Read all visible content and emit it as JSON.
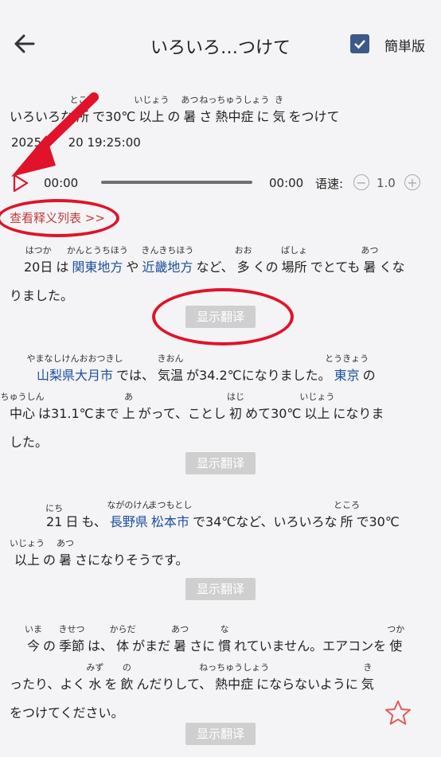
{
  "header": {
    "title": "いろいろ…つけて",
    "simple_label": "簡単版",
    "simple_checked": true
  },
  "headline": {
    "line": [
      {
        "t": "いろいろな",
        "r": ""
      },
      {
        "t": "所",
        "r": "ところ"
      },
      {
        "t": "で30℃",
        "r": ""
      },
      {
        "t": "以上",
        "r": "いじょう"
      },
      {
        "t": "の",
        "r": ""
      },
      {
        "t": "暑",
        "r": "あつ"
      },
      {
        "t": "さ",
        "r": ""
      },
      {
        "t": "熱中症",
        "r": "ねっちゅうしょう"
      },
      {
        "t": "に",
        "r": ""
      },
      {
        "t": "気",
        "r": "き"
      },
      {
        "t": "をつけて",
        "r": ""
      }
    ],
    "date": "2025-",
    "date_rest": "20 19:25:00"
  },
  "player": {
    "time_start": "00:00",
    "time_end": "00:00",
    "speed_label": "语速:",
    "speed_value": "1.0",
    "progress": 0
  },
  "gloss_link": "查看释义列表 >>",
  "translate_label": "显示翻译",
  "paragraphs": [
    {
      "lines": [
        [
          {
            "t": "20日",
            "r": "はつか"
          },
          {
            "t": "は",
            "r": ""
          },
          {
            "t": "関東地方",
            "r": "かんとうちほう",
            "blue": true
          },
          {
            "t": "や",
            "r": ""
          },
          {
            "t": "近畿地方",
            "r": "きんきちほう",
            "blue": true
          },
          {
            "t": "など、",
            "r": ""
          },
          {
            "t": "多",
            "r": "おお"
          },
          {
            "t": "くの",
            "r": ""
          },
          {
            "t": "場所",
            "r": "ばしょ"
          },
          {
            "t": "でとても",
            "r": ""
          },
          {
            "t": "暑",
            "r": "あつ"
          },
          {
            "t": "くな",
            "r": ""
          }
        ],
        [
          {
            "t": "りました。",
            "r": ""
          }
        ]
      ]
    },
    {
      "lines": [
        [
          {
            "t": "山梨県大月市",
            "r": "やまなしけんおおつきし",
            "blue": true
          },
          {
            "t": "では、",
            "r": ""
          },
          {
            "t": "気温",
            "r": "きおん"
          },
          {
            "t": "が34.2℃になりました。",
            "r": ""
          },
          {
            "t": "東京",
            "r": "とうきょう",
            "blue": true
          },
          {
            "t": "の",
            "r": ""
          }
        ],
        [
          {
            "t": "中心",
            "r": "ちゅうしん"
          },
          {
            "t": "は31.1℃まで",
            "r": ""
          },
          {
            "t": "上",
            "r": "あ"
          },
          {
            "t": "がって、ことし",
            "r": ""
          },
          {
            "t": "初",
            "r": "はじ"
          },
          {
            "t": "めて30℃",
            "r": ""
          },
          {
            "t": "以上",
            "r": "いじょう"
          },
          {
            "t": "になりま",
            "r": ""
          }
        ],
        [
          {
            "t": "した。",
            "r": ""
          }
        ]
      ]
    },
    {
      "lines": [
        [
          {
            "t": "21",
            "r": "にち"
          },
          {
            "t": "日",
            "r": ""
          },
          {
            "t": "も、",
            "r": ""
          },
          {
            "t": "長野県",
            "r": "ながのけん",
            "blue": true
          },
          {
            "t": "松本市",
            "r": "まつもとし",
            "blue": true
          },
          {
            "t": "で34℃など、いろいろな",
            "r": ""
          },
          {
            "t": "所",
            "r": "ところ"
          },
          {
            "t": "で30℃",
            "r": ""
          }
        ],
        [
          {
            "t": "以上",
            "r": "いじょう"
          },
          {
            "t": "の",
            "r": ""
          },
          {
            "t": "暑",
            "r": "あつ"
          },
          {
            "t": "さになりそうです。",
            "r": ""
          }
        ]
      ]
    },
    {
      "lines": [
        [
          {
            "t": "今",
            "r": "いま"
          },
          {
            "t": "の",
            "r": ""
          },
          {
            "t": "季節",
            "r": "きせつ"
          },
          {
            "t": "は、",
            "r": ""
          },
          {
            "t": "体",
            "r": "からだ"
          },
          {
            "t": "がまだ",
            "r": ""
          },
          {
            "t": "暑",
            "r": "あつ"
          },
          {
            "t": "さに",
            "r": ""
          },
          {
            "t": "慣",
            "r": "な"
          },
          {
            "t": "れていません。エアコンを",
            "r": ""
          },
          {
            "t": "使",
            "r": "つか"
          }
        ],
        [
          {
            "t": "ったり、よく",
            "r": ""
          },
          {
            "t": "水",
            "r": "みず"
          },
          {
            "t": "を",
            "r": ""
          },
          {
            "t": "飲",
            "r": "の"
          },
          {
            "t": "んだりして、",
            "r": ""
          },
          {
            "t": "熱中症",
            "r": "ねっちゅうしょう"
          },
          {
            "t": "にならないように",
            "r": ""
          },
          {
            "t": "気",
            "r": "き"
          }
        ],
        [
          {
            "t": "をつけてください。",
            "r": ""
          }
        ]
      ]
    }
  ],
  "colors": {
    "accent_red": "#e0132a",
    "link_red": "#c23b3b",
    "term_blue": "#1d4fa0",
    "checkbox": "#3b5a8a"
  }
}
